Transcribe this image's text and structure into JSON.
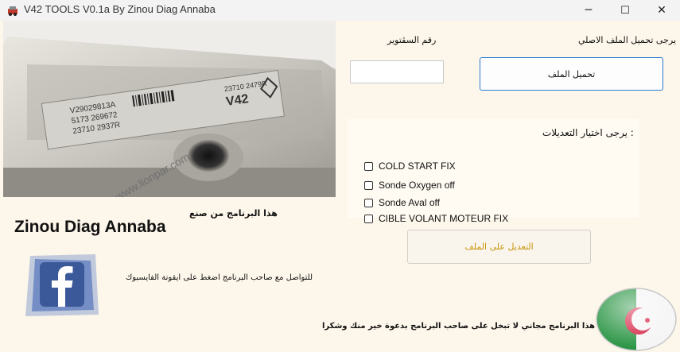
{
  "window": {
    "title": "V42 TOOLS V0.1a By Zinou Diag Annaba",
    "minimize_glyph": "─",
    "maximize_glyph": "☐",
    "close_glyph": "✕"
  },
  "ecu_image": {
    "part_number": "V29029813A",
    "line2": "5173 269672",
    "line3": "23710 2937R",
    "ref_top": "23710 2479R",
    "model": "V42",
    "watermark": "www.lionpar.com"
  },
  "serial": {
    "label": "رقم السڤتوير",
    "value": ""
  },
  "load": {
    "prompt": "يرجى تحميل الملف الاصلي",
    "button_label": "تحميل الملف"
  },
  "mods": {
    "heading": "يرجى اختيار التعديلات :",
    "options": [
      {
        "label": "COLD START FIX",
        "checked": false
      },
      {
        "label": "Sonde Oxygen off",
        "checked": false
      },
      {
        "label": "Sonde Aval off",
        "checked": false
      },
      {
        "label": "CIBLE VOLANT MOTEUR FIX",
        "checked": false
      }
    ]
  },
  "apply_button_label": "التعديل على الملف",
  "made_by_label": "هذا البرنامج من صنع",
  "brand_name": "Zinou Diag Annaba",
  "contact_text": "للتواصل مع صاحب البرنامج اضغط على ايقونة الفايسبوك",
  "footer_text": "هذا البرنامج مجاني لا تبخل على صاحب البرنامج بدعوة خير منك وشكرا",
  "colors": {
    "background": "#fdf6ea",
    "accent_border": "#2a7bd3",
    "apply_text": "#c9950c",
    "facebook_blue": "#3b5998",
    "flag_green": "#1e8f3a",
    "flag_red": "#d21034"
  },
  "icons": [
    "app-icon",
    "minimize-icon",
    "maximize-icon",
    "close-icon",
    "facebook-icon",
    "algeria-flag-icon"
  ]
}
